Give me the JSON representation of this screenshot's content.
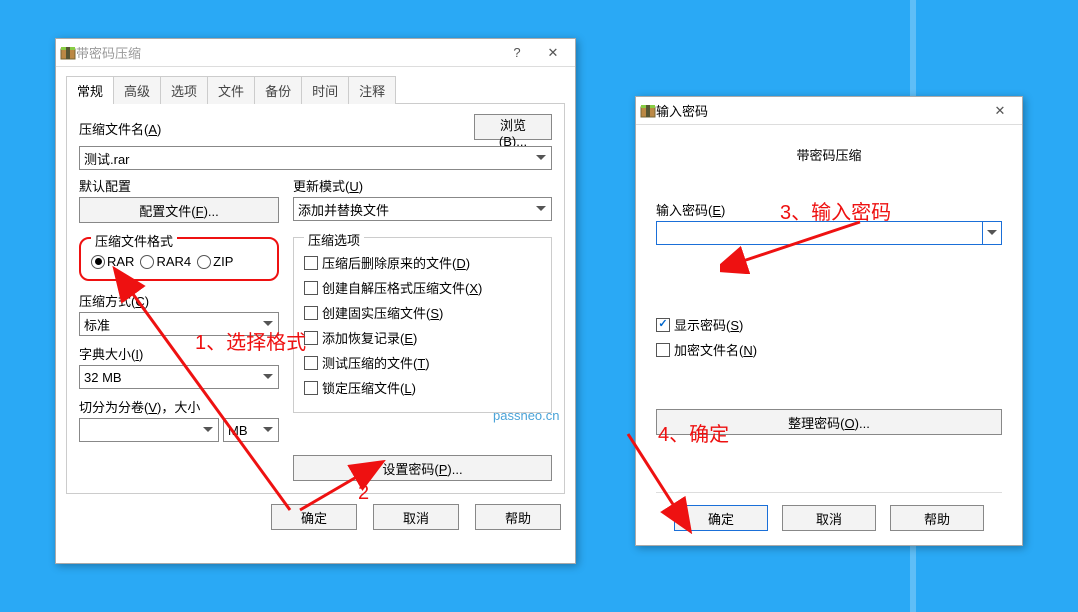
{
  "win1": {
    "title": "带密码压缩",
    "tabs": [
      "常规",
      "高级",
      "选项",
      "文件",
      "备份",
      "时间",
      "注释"
    ],
    "activeTab": 0,
    "archiveName": {
      "label": "压缩文件名(",
      "key": "A",
      "close": ")",
      "value": "测试.rar",
      "browse": "浏览(",
      "browseKey": "B",
      "browseClose": ")..."
    },
    "profile": {
      "legend": "默认配置",
      "button": "配置文件(",
      "key": "F",
      "close": ")..."
    },
    "updateMode": {
      "label": "更新模式(",
      "key": "U",
      "close": ")",
      "value": "添加并替换文件"
    },
    "format": {
      "legend": "压缩文件格式",
      "options": [
        {
          "label": "RAR",
          "checked": true
        },
        {
          "label": "RAR4",
          "checked": false
        },
        {
          "label": "ZIP",
          "checked": false
        }
      ]
    },
    "method": {
      "label": "压缩方式(",
      "key": "C",
      "close": ")",
      "value": "标准"
    },
    "dict": {
      "label": "字典大小(",
      "key": "I",
      "close": ")",
      "value": "32 MB"
    },
    "split": {
      "label": "切分为分卷(",
      "key": "V",
      "close": ")，大小",
      "unit": "MB"
    },
    "options": {
      "legend": "压缩选项",
      "items": [
        {
          "label": "压缩后删除原来的文件(",
          "key": "D",
          "close": ")",
          "checked": false
        },
        {
          "label": "创建自解压格式压缩文件(",
          "key": "X",
          "close": ")",
          "checked": false
        },
        {
          "label": "创建固实压缩文件(",
          "key": "S",
          "close": ")",
          "checked": false
        },
        {
          "label": "添加恢复记录(",
          "key": "E",
          "close": ")",
          "checked": false
        },
        {
          "label": "测试压缩的文件(",
          "key": "T",
          "close": ")",
          "checked": false
        },
        {
          "label": "锁定压缩文件(",
          "key": "L",
          "close": ")",
          "checked": false
        }
      ]
    },
    "setPassword": {
      "label": "设置密码(",
      "key": "P",
      "close": ")..."
    },
    "buttons": {
      "ok": "确定",
      "cancel": "取消",
      "help": "帮助"
    }
  },
  "win2": {
    "title": "输入密码",
    "subtitle": "带密码压缩",
    "pwdLabel": {
      "label": "输入密码(",
      "key": "E",
      "close": ")"
    },
    "pwdValue": "",
    "showPwd": {
      "label": "显示密码(",
      "key": "S",
      "close": ")",
      "checked": true
    },
    "encryptNames": {
      "label": "加密文件名(",
      "key": "N",
      "close": ")",
      "checked": false
    },
    "organize": {
      "label": "整理密码(",
      "key": "O",
      "close": ")..."
    },
    "buttons": {
      "ok": "确定",
      "cancel": "取消",
      "help": "帮助"
    }
  },
  "annotations": {
    "a1": "1、选择格式",
    "a2": "2",
    "a3": "3、输入密码",
    "a4": "4、确定"
  },
  "watermark": "passneo.cn"
}
